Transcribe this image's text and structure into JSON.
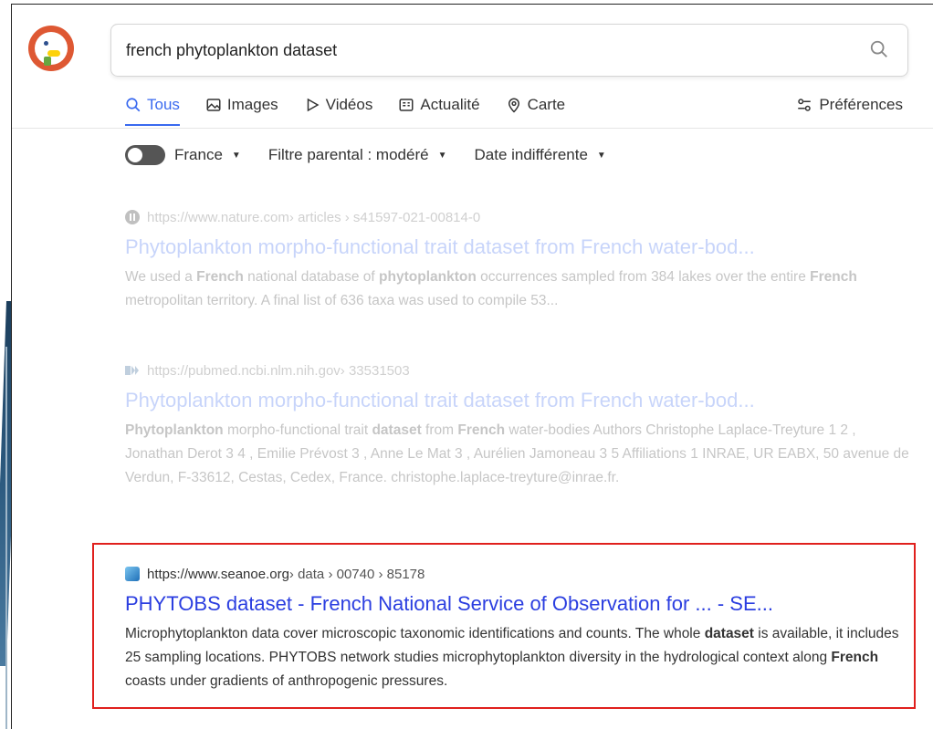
{
  "search": {
    "query": "french phytoplankton dataset"
  },
  "tabs": [
    {
      "label": "Tous",
      "icon": "search-icon"
    },
    {
      "label": "Images",
      "icon": "image-icon"
    },
    {
      "label": "Vidéos",
      "icon": "play-icon"
    },
    {
      "label": "Actualité",
      "icon": "newspaper-icon"
    },
    {
      "label": "Carte",
      "icon": "map-pin-icon"
    }
  ],
  "preferences": {
    "label": "Préférences",
    "icon": "sliders-icon"
  },
  "filters": {
    "region": "France",
    "safe_search": "Filtre parental : modéré",
    "date": "Date indifférente"
  },
  "results": [
    {
      "url": "https://www.nature.com",
      "path": " › articles › s41597-021-00814-0",
      "title": "Phytoplankton morpho-functional trait dataset from French water-bod...",
      "snippet_parts": [
        {
          "t": "We used a ",
          "b": false
        },
        {
          "t": "French",
          "b": true
        },
        {
          "t": " national database of ",
          "b": false
        },
        {
          "t": "phytoplankton",
          "b": true
        },
        {
          "t": " occurrences sampled from 384 lakes over the entire ",
          "b": false
        },
        {
          "t": "French",
          "b": true
        },
        {
          "t": " metropolitan territory. A final list of 636 taxa was used to compile 53...",
          "b": false
        }
      ],
      "favicon_color": "#222222"
    },
    {
      "url": "https://pubmed.ncbi.nlm.nih.gov",
      "path": " › 33531503",
      "title": "Phytoplankton morpho-functional trait dataset from French water-bod...",
      "snippet_parts": [
        {
          "t": "Phytoplankton",
          "b": true
        },
        {
          "t": " morpho-functional trait ",
          "b": false
        },
        {
          "t": "dataset",
          "b": true
        },
        {
          "t": " from ",
          "b": false
        },
        {
          "t": "French",
          "b": true
        },
        {
          "t": " water-bodies Authors Christophe Laplace-Treyture 1 2 , Jonathan Derot 3 4 , Emilie Prévost 3 , Anne Le Mat 3 , Aurélien Jamoneau 3 5 Affiliations 1 INRAE, UR EABX, 50 avenue de Verdun, F-33612, Cestas, Cedex, France. christophe.laplace-treyture@inrae.fr.",
          "b": false
        }
      ],
      "favicon_color": "#20558a"
    },
    {
      "url": "https://www.seanoe.org",
      "path": " › data › 00740 › 85178",
      "title": "PHYTOBS dataset - French National Service of Observation for ... - SE...",
      "snippet_parts": [
        {
          "t": "Microphytoplankton data cover microscopic taxonomic identifications and counts. The whole ",
          "b": false
        },
        {
          "t": "dataset",
          "b": true
        },
        {
          "t": " is available, it includes 25 sampling locations. PHYTOBS network studies microphytoplankton diversity in the hydrological context along ",
          "b": false
        },
        {
          "t": "French",
          "b": true
        },
        {
          "t": " coasts under gradients of anthropogenic pressures.",
          "b": false
        }
      ],
      "favicon_color": "#2f8fd8"
    }
  ],
  "colors": {
    "accent": "#3969ef",
    "title_link": "#2b3ee0",
    "highlight": "#e0201d",
    "logo": "#de5833"
  }
}
